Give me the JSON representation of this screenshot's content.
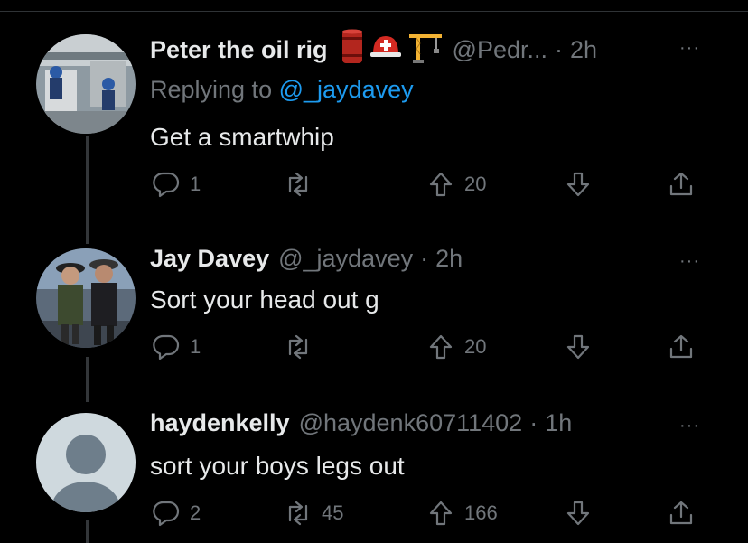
{
  "tweets": [
    {
      "name": "Peter the oil rig",
      "emoji": [
        "oil-drum-icon",
        "rescue-helmet-icon",
        "crane-icon"
      ],
      "handle": "@Pedr...",
      "time": "2h",
      "reply_prefix": "Replying to",
      "reply_handle": "@_jaydavey",
      "text": "Get a smartwhip",
      "replies": "1",
      "retweets": "",
      "upvotes": "20"
    },
    {
      "name": "Jay Davey",
      "handle": "@_jaydavey",
      "time": "2h",
      "text": "Sort your head out g",
      "replies": "1",
      "retweets": "",
      "upvotes": "20"
    },
    {
      "name": "haydenkelly",
      "handle": "@haydenk60711402",
      "time": "1h",
      "text": "sort your boys legs out",
      "replies": "2",
      "retweets": "45",
      "upvotes": "166"
    }
  ],
  "sep": "·",
  "more_label": "···",
  "colors": {
    "background": "#000000",
    "text": "#e7e9ea",
    "muted": "#71767b",
    "link": "#1d9bf0",
    "thread_line": "#333639"
  }
}
